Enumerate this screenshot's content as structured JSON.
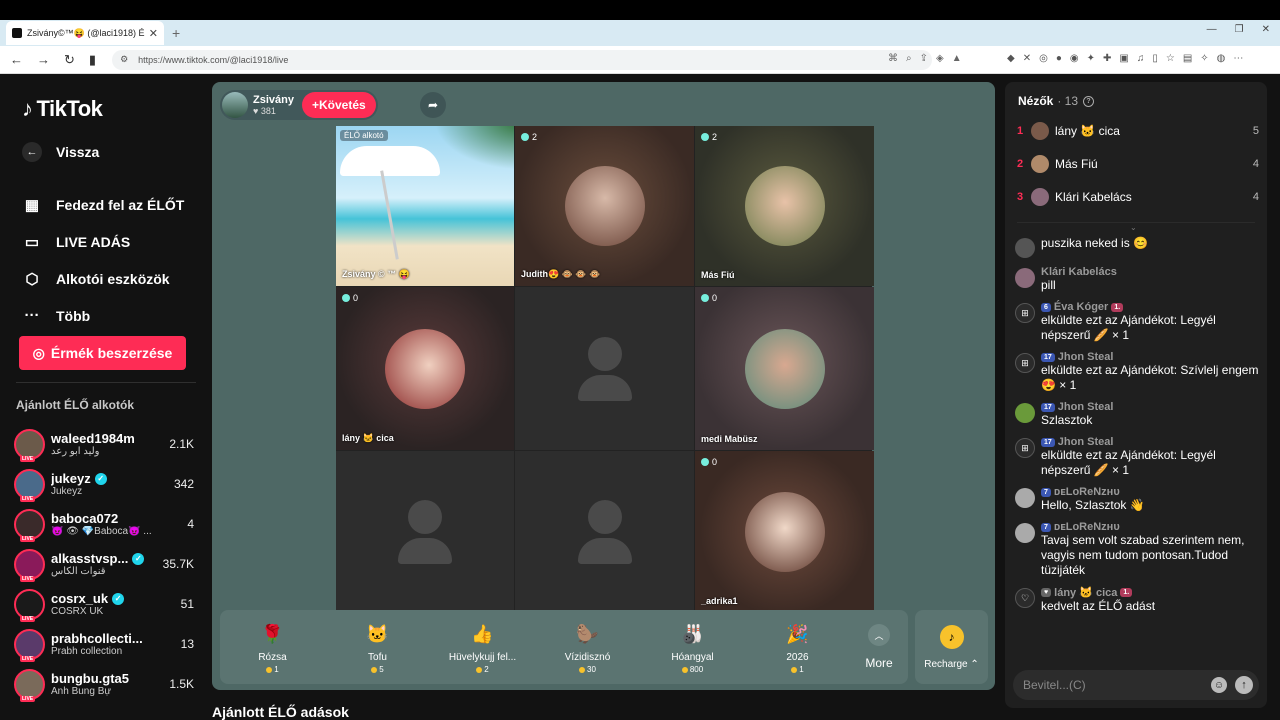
{
  "browser": {
    "tab_title": "Zsivány©™😝 (@laci1918) Él...",
    "url": "https://www.tiktok.com/@laci1918/live"
  },
  "sidebar": {
    "logo": "TikTok",
    "back": "Vissza",
    "menu": [
      {
        "icon": "live-calendar-icon",
        "label": "Fedezd fel az ÉLŐT"
      },
      {
        "icon": "camera-icon",
        "label": "LIVE ADÁS"
      },
      {
        "icon": "creator-tools-icon",
        "label": "Alkotói eszközök"
      },
      {
        "icon": "more-dots-icon",
        "label": "Több"
      }
    ],
    "coins_button": "Érmék beszerzése",
    "recommended_title": "Ajánlott ÉLŐ alkotók",
    "creators": [
      {
        "name": "waleed1984m",
        "sub": "وليد ابو رعد",
        "count": "2.1K",
        "verified": false
      },
      {
        "name": "jukeyz",
        "sub": "Jukeyz",
        "count": "342",
        "verified": true
      },
      {
        "name": "baboca072",
        "sub": "😈 👁 💎Baboca😈 ...",
        "count": "4",
        "verified": false
      },
      {
        "name": "alkasstvsp...",
        "sub": "قنوات الكأس",
        "count": "35.7K",
        "verified": true
      },
      {
        "name": "cosrx_uk",
        "sub": "COSRX UK",
        "count": "51",
        "verified": true
      },
      {
        "name": "prabhcollecti...",
        "sub": "Prabh collection",
        "count": "13",
        "verified": false
      },
      {
        "name": "bungbu.gta5",
        "sub": "Anh Bung Bự",
        "count": "1.5K",
        "verified": false
      }
    ]
  },
  "stage": {
    "host_name": "Zsivány",
    "host_likes": "381",
    "follow_label": "Követés",
    "cells": [
      {
        "tag": "ÉLŐ alkotó",
        "name": "Zsivány © ™ 😝",
        "count": ""
      },
      {
        "tag": "",
        "name": "Judith😍 🐵 🐵 🐵",
        "count": "2"
      },
      {
        "tag": "",
        "name": "Más Fiú",
        "count": "2"
      },
      {
        "tag": "",
        "name": "lány 🐱 cica",
        "count": "0"
      },
      {
        "tag": "",
        "name": "",
        "count": ""
      },
      {
        "tag": "",
        "name": "medi Mabüsz",
        "count": "0"
      },
      {
        "tag": "",
        "name": "",
        "count": ""
      },
      {
        "tag": "",
        "name": "",
        "count": ""
      },
      {
        "tag": "",
        "name": "_adrika1",
        "count": "0"
      }
    ],
    "gifts": [
      {
        "icon": "🌹",
        "name": "Rózsa",
        "price": "1"
      },
      {
        "icon": "🐱",
        "name": "Tofu",
        "price": "5"
      },
      {
        "icon": "👍",
        "name": "Hüvelykujj fel...",
        "price": "2"
      },
      {
        "icon": "🦫",
        "name": "Vízidisznó",
        "price": "30"
      },
      {
        "icon": "🎳",
        "name": "Hóangyal",
        "price": "800"
      },
      {
        "icon": "🎉",
        "name": "2026",
        "price": "1"
      }
    ],
    "more_label": "More",
    "recharge_label": "Recharge"
  },
  "below_title": "Ajánlott ÉLŐ adások",
  "chat": {
    "viewers_label": "Nézők",
    "viewers_count": "· 13",
    "ranking": [
      {
        "rank": "1",
        "name": "lány 🐱 cica",
        "score": "5"
      },
      {
        "rank": "2",
        "name": "Más Fiú",
        "score": "4"
      },
      {
        "rank": "3",
        "name": "Klári Kabelács",
        "score": "4"
      }
    ],
    "messages": [
      {
        "type": "user",
        "name": "",
        "badges": [],
        "text": "puszika neked is 😊"
      },
      {
        "type": "user",
        "name": "Klári Kabelács",
        "badges": [],
        "text": "pill"
      },
      {
        "type": "gift",
        "name": "Éva Kóger",
        "badges": [
          "6",
          "1."
        ],
        "text": "elküldte ezt az Ajándékot: Legyél népszerű 🥖 × 1"
      },
      {
        "type": "gift",
        "name": "Jhon Steal",
        "badges": [
          "17"
        ],
        "text": "elküldte ezt az Ajándékot: Szívlelj engem 😍 × 1"
      },
      {
        "type": "user",
        "name": "Jhon Steal",
        "badges": [
          "17"
        ],
        "text": "Szlasztok"
      },
      {
        "type": "gift",
        "name": "Jhon Steal",
        "badges": [
          "17"
        ],
        "text": "elküldte ezt az Ajándékot: Legyél népszerű 🥖 × 1"
      },
      {
        "type": "user",
        "name": "ᴅᴇLoReNᴢʜᴜ",
        "badges": [
          "7"
        ],
        "text": "Hello, Szlasztok 👋"
      },
      {
        "type": "user",
        "name": "ᴅᴇLoReNᴢʜᴜ",
        "badges": [
          "7"
        ],
        "text": "Tavaj sem volt szabad szerintem nem, vagyis nem tudom pontosan.Tudod tüzijáték"
      },
      {
        "type": "like",
        "name": "lány 🐱 cica",
        "badges": [
          "1."
        ],
        "text": "kedvelt az ÉLŐ adást"
      }
    ],
    "input_placeholder": "Bevitel...(C)"
  }
}
